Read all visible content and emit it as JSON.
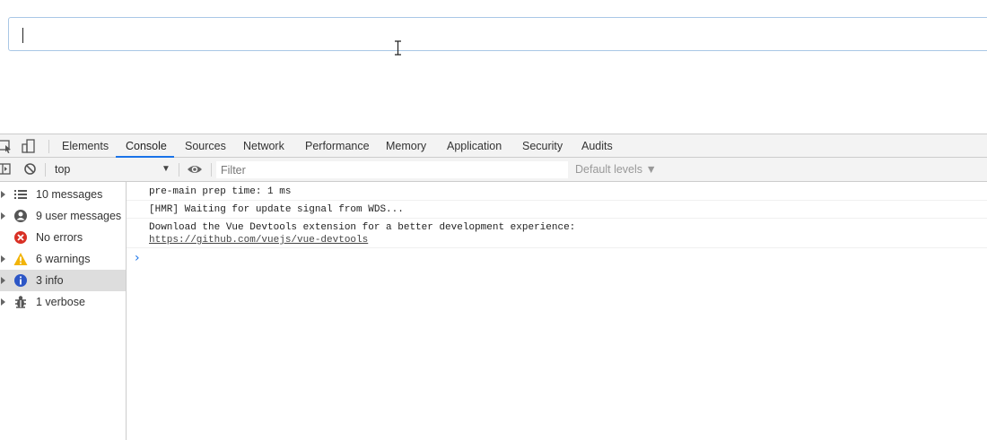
{
  "page": {
    "input_value": ""
  },
  "devtools": {
    "tabs": [
      {
        "label": "Elements"
      },
      {
        "label": "Console",
        "active": true
      },
      {
        "label": "Sources"
      },
      {
        "label": "Network"
      },
      {
        "label": "Performance"
      },
      {
        "label": "Memory"
      },
      {
        "label": "Application"
      },
      {
        "label": "Security"
      },
      {
        "label": "Audits"
      }
    ],
    "toolbar": {
      "context": "top",
      "context_arrow": "▼",
      "filter_placeholder": "Filter",
      "filter_value": "",
      "levels": "Default levels ▼"
    },
    "sidebar": [
      {
        "label": "10 messages",
        "icon": "list-icon"
      },
      {
        "label": "9 user messages",
        "icon": "user-icon"
      },
      {
        "label": "No errors",
        "icon": "error-icon"
      },
      {
        "label": "6 warnings",
        "icon": "warning-icon"
      },
      {
        "label": "3 info",
        "icon": "info-icon",
        "selected": true
      },
      {
        "label": "1 verbose",
        "icon": "bug-icon"
      }
    ],
    "messages": [
      {
        "text": "pre-main prep time: 1 ms"
      },
      {
        "text": "[HMR] Waiting for update signal from WDS..."
      },
      {
        "text": "Download the Vue Devtools extension for a better development experience:",
        "link": "https://github.com/vuejs/vue-devtools"
      }
    ],
    "prompt": "›"
  },
  "colors": {
    "accent": "#1a73e8",
    "error": "#d93025",
    "warning": "#f2b40a",
    "info": "#2c56c6"
  }
}
